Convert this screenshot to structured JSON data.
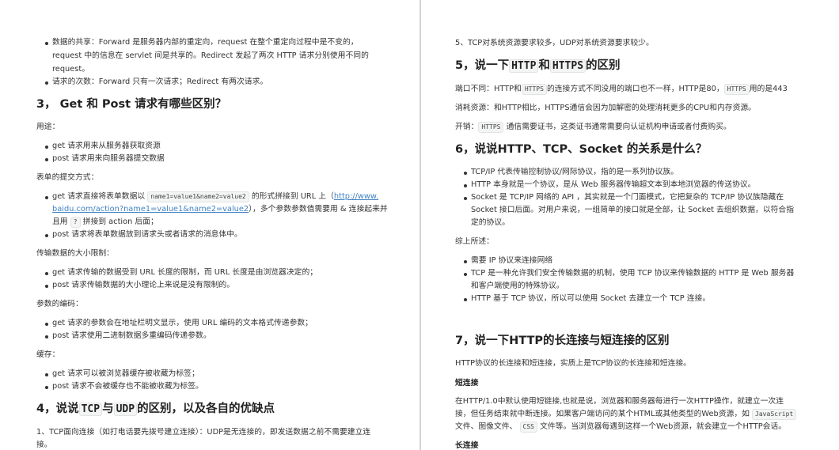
{
  "left": {
    "b1_line1": "数据的共享：Forward 是服务器内部的重定向，request 在整个重定向过程中是不变的，",
    "b1_line2": "request 中的信息在 servlet 间是共享的。Redirect 发起了两次 HTTP 请求分别使用不同的",
    "b1_line3": "request。",
    "b2": "请求的次数：Forward 只有一次请求；Redirect 有两次请求。",
    "h3": "3， Get 和 Post 请求有哪些区别？",
    "usage_label": "用途：",
    "usage_1": "get 请求用来从服务器获取资源",
    "usage_2": "post 请求用来向服务器提交数据",
    "form_label": "表单的提交方式：",
    "form_1_pre": "get 请求直接将表单数据以",
    "form_1_code": "name1=value1&name2=value2",
    "form_1_mid": "的形式拼接到 URL 上（",
    "form_1_link1": "http://www.",
    "form_1_link2": "baidu.com/action?name1=value1&name2=value2",
    "form_1_post": "），多个参数参数值需要用 & 连接起来并",
    "form_1_l3_pre": "且用",
    "form_1_l3_code": "?",
    "form_1_l3_post": "拼接到 action 后面；",
    "form_2": "post 请求将表单数据放到请求头或者请求的消息体中。",
    "size_label": "传输数据的大小限制：",
    "size_1": "get 请求传输的数据受到 URL 长度的限制，而 URL 长度是由浏览器决定的；",
    "size_2": "post 请求传输数据的大小理论上来说是没有限制的。",
    "encode_label": "参数的编码：",
    "encode_1": "get 请求的参数会在地址栏明文显示，使用 URL 编码的文本格式传递参数；",
    "encode_2": "post 请求使用二进制数据多重编码传递参数。",
    "cache_label": "缓存：",
    "cache_1": "get 请求可以被浏览器缓存被收藏为标签；",
    "cache_2": "post 请求不会被缓存也不能被收藏为标签。",
    "h4_pre": "4，说说",
    "h4_code1": "TCP",
    "h4_mid": "与",
    "h4_code2": "UDP",
    "h4_post": "的区别，以及各自的优缺点",
    "tcp_1_line1": "1、TCP面向连接（如打电话要先拨号建立连接）：UDP是无连接的，即发送数据之前不需要建立连",
    "tcp_1_line2": "接。"
  },
  "right": {
    "p5_top": "5、TCP对系统资源要求较多，UDP对系统资源要求较少。",
    "h5_pre": "5，说一下",
    "h5_code1": "HTTP",
    "h5_mid": "和",
    "h5_code2": "HTTPS",
    "h5_post": "的区别",
    "port_pre": "端口不同：HTTP和",
    "port_code1": "HTTPS",
    "port_mid": "的连接方式不同没用的端口也不一样，HTTP是80，",
    "port_code2": "HTTPS",
    "port_post": "用的是443",
    "cost": "消耗资源：和HTTP相比，HTTPS通信会因为加解密的处理消耗更多的CPU和内存资源。",
    "fee_pre": "开销：",
    "fee_code": "HTTPS",
    "fee_post": "通信需要证书，这类证书通常需要向认证机构申请或者付费购买。",
    "h6": "6，说说HTTP、TCP、Socket 的关系是什么？",
    "rel_1": "TCP/IP 代表传输控制协议/网际协议，指的是一系列协议族。",
    "rel_2": "HTTP 本身就是一个协议，是从 Web 服务器传输超文本到本地浏览器的传送协议。",
    "rel_3_l1": "Socket 是 TCP/IP 网络的 API ，其实就是一个门面模式，它把复杂的 TCP/IP 协议族隐藏在",
    "rel_3_l2": "Socket 接口后面。对用户来说，一组简单的接口就是全部，让 Socket 去组织数据，以符合指",
    "rel_3_l3": "定的协议。",
    "sum_label": "综上所述：",
    "sum_1": "需要 IP 协议来连接网络",
    "sum_2_l1": "TCP 是一种允许我们安全传输数据的机制，使用 TCP 协议来传输数据的 HTTP 是 Web 服务器",
    "sum_2_l2": "和客户端使用的特殊协议。",
    "sum_3": "HTTP 基于 TCP 协议，所以可以使用 Socket 去建立一个 TCP 连接。",
    "h7": "7，说一下HTTP的长连接与短连接的区别",
    "p7_intro": "HTTP协议的长连接和短连接，实质上是TCP协议的长连接和短连接。",
    "short_label": "短连接",
    "short_l1": "在HTTP/1.0中默认使用短链接,也就是说，浏览器和服务器每进行一次HTTP操作，就建立一次连",
    "short_l2_pre": "接，但任务结束就中断连接。如果客户端访问的某个HTML或其他类型的Web资源，如",
    "short_l2_code": "JavaScript",
    "short_l3_pre": "文件、图像文件、",
    "short_l3_code": "CSS",
    "short_l3_post": "文件等。当浏览器每遇到这样一个Web资源，就会建立一个HTTP会话。",
    "long_label": "长连接"
  }
}
